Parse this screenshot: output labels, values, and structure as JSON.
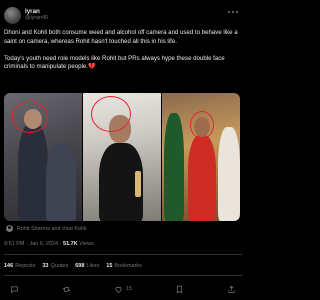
{
  "author": {
    "display_name": "Iyran",
    "handle": "@iyran45",
    "verified_color": "#1d9bf0"
  },
  "post": {
    "paragraph_1": "Dhoni and Kohli both consume weed and alcohol off camera and used to behave like a saint on camera, whereas Rohit hasn't touched all this in his life.",
    "paragraph_2": "Today's youth need role models like Rohit but PRs always hype these double face criminals to manipulate people.💔"
  },
  "media": {
    "tag_text": "Rohit Sharma and Virat Kohli",
    "photo_count": 3,
    "highlight_color": "#e0262b"
  },
  "meta": {
    "time": "9:51 PM",
    "date": "Jan 6, 2024",
    "views": "51.7K",
    "views_label": "Views"
  },
  "stats": {
    "reposts": "146",
    "reposts_label": "Reposts",
    "quotes": "33",
    "quotes_label": "Quotes",
    "likes": "698",
    "likes_label": "Likes",
    "bookmarks": "15",
    "bookmarks_label": "Bookmarks"
  },
  "actions": {
    "reply_icon": "reply-icon",
    "repost_icon": "repost-icon",
    "like_icon": "heart-icon",
    "like_count": "15",
    "bookmark_icon": "bookmark-icon",
    "share_icon": "share-icon"
  },
  "colors": {
    "background": "#000000",
    "text": "#e7e9ea",
    "muted": "#71767b",
    "divider": "#2f3336"
  }
}
